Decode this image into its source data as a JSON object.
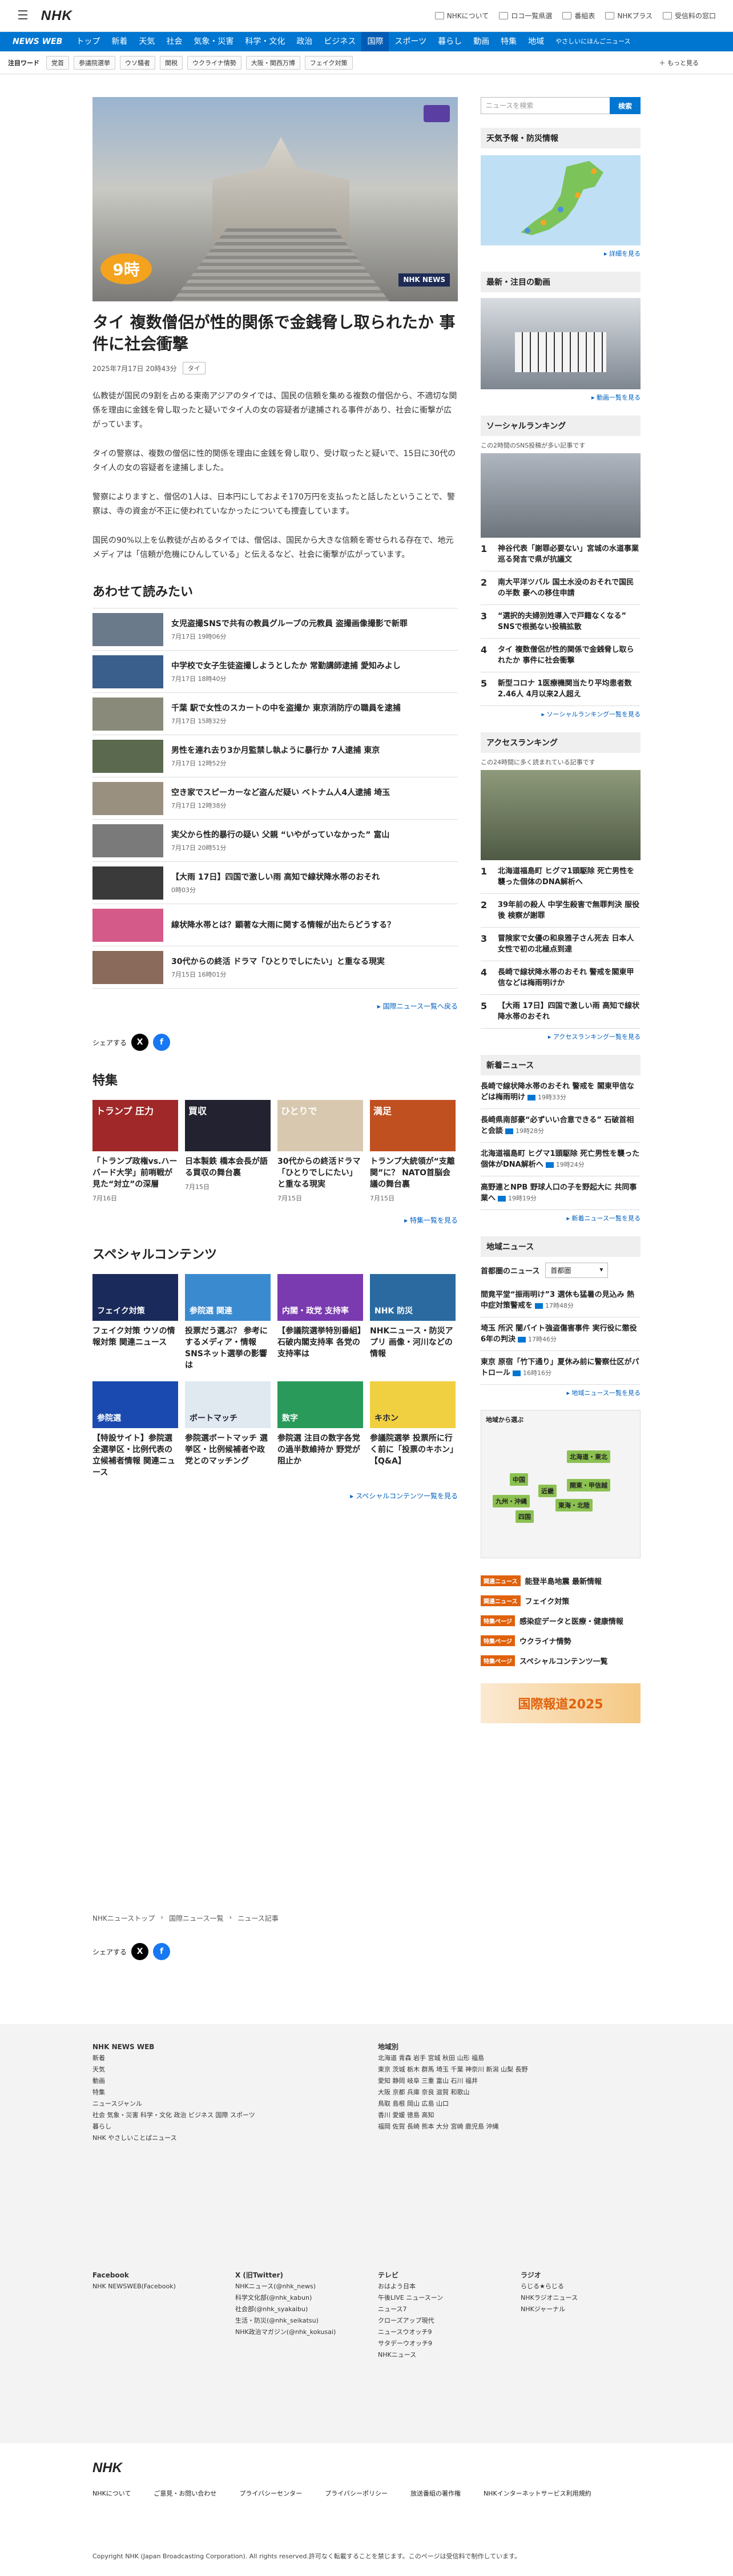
{
  "header": {
    "logo": "NHK",
    "menu_icon": "hamburger-icon",
    "links": [
      "NHKについて",
      "ロコ一覧県選",
      "番組表",
      "NHKプラス",
      "受信料の窓口"
    ]
  },
  "nav": {
    "brand": "NEWS WEB",
    "items": [
      "トップ",
      "新着",
      "天気",
      "社会",
      "気象・災害",
      "科学・文化",
      "政治",
      "ビジネス",
      "国際",
      "スポーツ",
      "暮らし",
      "動画",
      "特集",
      "地域",
      "やさしいにほんごニュース"
    ],
    "active": "国際"
  },
  "keywords": {
    "label": "注目ワード",
    "items": [
      "党首",
      "参議院選挙",
      "ウソ騒者",
      "関税",
      "ウクライナ情勢",
      "大阪・関西万博",
      "フェイク対策"
    ],
    "more": "もっと見る"
  },
  "article": {
    "title": "タイ 複数僧侶が性的関係で金銭脅し取られたか 事件に社会衝撃",
    "date": "2025年7月17日 20時43分",
    "tag": "タイ",
    "hero_badge": "9時",
    "hero_logo": "NHK NEWS",
    "paragraphs": [
      "仏教徒が国民の9割を占める東南アジアのタイでは、国民の信頼を集める複数の僧侶から、不適切な関係を理由に金銭を脅し取ったと疑いでタイ人の女の容疑者が逮捕される事件があり、社会に衝撃が広がっています。",
      "タイの警察は、複数の僧侶に性的関係を理由に金銭を脅し取り、受け取ったと疑いで、15日に30代のタイ人の女の容疑者を逮捕しました。",
      "警察によりますと、僧侶の1人は、日本円にしておよそ170万円を支払ったと話したということで、警察は、寺の資金が不正に使われていなかったについても捜査しています。",
      "国民の90%以上を仏教徒が占めるタイでは、僧侶は、国民から大きな信頼を寄せられる存在で、地元メディアは「信頼が危機にひんしている」と伝えるなど、社会に衝撃が広がっています。"
    ]
  },
  "related": {
    "heading": "あわせて読みたい",
    "items": [
      {
        "title": "女児盗撮SNSで共有の教員グループの元教員 盗撮画像撮影で新罪",
        "date": "7月17日 19時06分",
        "color": "#6a7a8a"
      },
      {
        "title": "中学校で女子生徒盗撮しようとしたか 常勤講師逮捕 愛知みよし",
        "date": "7月17日 18時40分",
        "color": "#3b5f8c"
      },
      {
        "title": "千葉 駅で女性のスカートの中を盗撮か 東京消防庁の職員を逮捕",
        "date": "7月17日 15時32分",
        "color": "#8a8a7a"
      },
      {
        "title": "男性を連れ去り3か月監禁し執ように暴行か 7人逮捕 東京",
        "date": "7月17日 12時52分",
        "color": "#5b6a4f"
      },
      {
        "title": "空き家でスピーカーなど盗んだ疑い ベトナム人4人逮捕 埼玉",
        "date": "7月17日 12時38分",
        "color": "#9a9080"
      },
      {
        "title": "実父から性的暴行の疑い 父親 “いやがっていなかった” 富山",
        "date": "7月17日 20時51分",
        "color": "#7a7a7a"
      },
      {
        "title": "【大雨 17日】四国で激しい雨 高知で線状降水帯のおそれ",
        "date": "0時03分",
        "color": "#3a3a3a"
      },
      {
        "title": "線状降水帯とは？顕著な大雨に関する情報が出たらどうする？",
        "date": "",
        "color": "#d45a8a"
      },
      {
        "title": "30代からの終活 ドラマ「ひとりでしにたい」と重なる現実",
        "date": "7月15日 16時01分",
        "color": "#8a6a5a"
      }
    ],
    "more": "国際ニュース一覧へ戻る"
  },
  "share": {
    "label": "シェアする"
  },
  "features": {
    "heading": "特集",
    "items": [
      {
        "title": "「トランプ政権vs.ハーバード大学」前哨戦が見た“対立”の深層",
        "date": "7月16日",
        "img": "トランプ 圧力",
        "color": "#a02828"
      },
      {
        "title": "日本製鉄 橋本会長が語る買収の舞台裏",
        "date": "7月15日",
        "img": "買収",
        "color": "#222230"
      },
      {
        "title": "30代からの終活ドラマ「ひとりでしにたい」と重なる現実",
        "date": "7月15日",
        "img": "ひとりで",
        "color": "#d8c8b0"
      },
      {
        "title": "トランプ大統領が“支離関”に？ NATO首脳会議の舞台裏",
        "date": "7月15日",
        "img": "満足",
        "color": "#c05020"
      }
    ],
    "more": "特集一覧を見る"
  },
  "special": {
    "heading": "スペシャルコンテンツ",
    "items": [
      {
        "title": "フェイク対策 ウソの情報対策 関連ニュース",
        "img": "フェイク対策",
        "color": "#1a2a5a"
      },
      {
        "title": "投票だう選ぶ？ 参考にするメディア・情報 SNSネット選挙の影響は",
        "img": "参院選 関連",
        "color": "#3a8ad0"
      },
      {
        "title": "【参議院選挙特別番組】石破内閣支持率 各党の支持率は",
        "img": "内閣・政党 支持率",
        "color": "#7a3ab0"
      },
      {
        "title": "NHKニュース・防災アプリ 画像・河川などの情報",
        "img": "NHK 防災",
        "color": "#2a6aa0"
      },
      {
        "title": "【特設サイト】参院選 全選挙区・比例代表の立候補者情報 関連ニュース",
        "img": "参院選",
        "color": "#1a4ab0"
      },
      {
        "title": "参院選ボートマッチ 選挙区・比例候補者や政党とのマッチング",
        "img": "ボートマッチ",
        "color": "#e0e8f0"
      },
      {
        "title": "参院選 注目の数字各党の過半数維持か 野党が阻止か",
        "img": "数字",
        "color": "#2a9a5a"
      },
      {
        "title": "参議院選挙 投票所に行く前に「投票のキホン」【Q&A】",
        "img": "キホン",
        "color": "#f0d040"
      }
    ],
    "more": "スペシャルコンテンツ一覧を見る"
  },
  "sidebar": {
    "search_placeholder": "ニュースを検索",
    "search_button": "検索",
    "weather": {
      "heading": "天気予報・防災情報",
      "more": "詳細を見る"
    },
    "video": {
      "heading": "最新・注目の動画",
      "more": "動画一覧を見る"
    },
    "social": {
      "heading": "ソーシャルランキング",
      "sub": "この2時間のSNS投稿が多い記事です",
      "items": [
        "神谷代表「謝罪必要ない」宮城の水道事業巡る発言で県が抗議文",
        "南大平洋ツバル 国土水没のおそれで国民の半数 豪への移住申請",
        "“選択的夫婦別姓導入で戸籍なくなる” SNSで根拠ない投稿拡散",
        "タイ 複数僧侶が性的関係で金銭脅し取られたか 事件に社会衝撃",
        "新型コロナ 1医療機関当たり平均患者数2.46人 4月以来2人超え"
      ],
      "more": "ソーシャルランキング一覧を見る"
    },
    "access": {
      "heading": "アクセスランキング",
      "sub": "この24時間に多く読まれている記事です",
      "items": [
        "北海道福島町 ヒグマ1頭駆除 死亡男性を襲った個体のDNA解析へ",
        "39年前の殺人 中学生殺害で無罪判決 服役後 検察が謝罪",
        "冒険家で女優の和泉雅子さん死去 日本人女性で初の北極点到達",
        "長崎で線状降水帯のおそれ 警戒を閣東甲信などは梅雨明けか",
        "【大雨 17日】四国で激しい雨 高知で線状降水帯のおそれ"
      ],
      "more": "アクセスランキング一覧を見る"
    },
    "news": {
      "heading": "新着ニュース",
      "items": [
        {
          "t": "長崎で線状降水帯のおそれ 警戒を 閣東甲信などは梅雨明け",
          "tm": "19時33分"
        },
        {
          "t": "長崎県南部豪“必ずいい合意できる” 石破首相と会談",
          "tm": "19時28分"
        },
        {
          "t": "北海道福島町 ヒグマ1頭駆除 死亡男性を襲った個体がDNA解析へ",
          "tm": "19時24分"
        },
        {
          "t": "高野連とNPB 野球人口の子を野起大に 共同事業へ",
          "tm": "19時19分"
        }
      ],
      "more": "新着ニュース一覧を見る"
    },
    "region": {
      "heading": "地域ニュース",
      "label": "首都圏のニュース",
      "select": "首都圏",
      "items": [
        {
          "t": "間竟平堂“振雨明け”3 選休も猛暑の見込み 熱中症対策警戒を",
          "tm": "17時48分"
        },
        {
          "t": "埼玉 所沢 闇バイト強盗傷害事件 実行役に懲役6年の判決",
          "tm": "17時46分"
        },
        {
          "t": "東京 原宿「竹下通り」夏休み前に警察仕区がパトロール",
          "tm": "16時16分"
        }
      ],
      "more": "地域ニュース一覧を見る",
      "map_title": "地域から選ぶ",
      "regions": [
        "北海道・東北",
        "中国",
        "九州・沖縄",
        "近畿",
        "関東・甲信越",
        "東海・北陸",
        "四国"
      ]
    },
    "specials": [
      {
        "lbl": "関連ニュース",
        "t": "能登半島地震 最新情報"
      },
      {
        "lbl": "関連ニュース",
        "t": "フェイク対策"
      },
      {
        "lbl": "特集ページ",
        "t": "感染症データと医療・健康情報"
      },
      {
        "lbl": "特集ページ",
        "t": "ウクライナ情勢"
      },
      {
        "lbl": "特集ページ",
        "t": "スペシャルコンテンツ一覧"
      }
    ],
    "banner": "国際報道2025"
  },
  "breadcrumb": [
    "NHKニューストップ",
    "国際ニュース一覧",
    "ニュース記事"
  ],
  "footer": {
    "brand": "NHK NEWS WEB",
    "col1": [
      "新着",
      "天気",
      "動画",
      "特集",
      "ニュースジャンル",
      "社会 気象・災害 科学・文化 政治 ビジネス 国際 スポーツ",
      "暮らし",
      "NHK やさしいことばニュース"
    ],
    "region_hd": "地域別",
    "regions": [
      "北海道 青森 岩手 宮城 秋田 山形 福島",
      "東京 茨城 栃木 群馬 埼玉 千葉 神奈川 新潟 山梨 長野",
      "愛知 静岡 岐阜 三重 富山 石川 福井",
      "大阪 京都 兵庫 奈良 滋賀 和歌山",
      "鳥取 島根 岡山 広島 山口",
      "香川 愛媛 徳島 高知",
      "福岡 佐賀 長崎 熊本 大分 宮崎 鹿児島 沖縄"
    ],
    "sns": [
      {
        "hd": "Facebook",
        "items": [
          "NHK NEWSWEB(Facebook)"
        ]
      },
      {
        "hd": "X (旧Twitter)",
        "items": [
          "NHKニュース(@nhk_news)",
          "科学文化部(@nhk_kabun)",
          "社会部(@nhk_syakaibu)",
          "生活・防災(@nhk_seikatsu)",
          "NHK政治マガジン(@nhk_kokusai)"
        ]
      },
      {
        "hd": "テレビ",
        "items": [
          "おはよう日本",
          "午後LIVE ニュースーン",
          "ニュース7",
          "クローズアップ現代",
          "ニュースウオッチ9",
          "サタデーウオッチ9",
          "NHKニュース"
        ]
      },
      {
        "hd": "ラジオ",
        "items": [
          "らじる★らじる",
          "NHKラジオニュース",
          "NHKジャーナル"
        ]
      }
    ],
    "bottom_logo": "NHK",
    "bottom_links": [
      "NHKについて",
      "ご意見・お問い合わせ",
      "プライバシーセンター",
      "プライバシーポリシー",
      "放送番組の著作権",
      "NHKインターネットサービス利用規約"
    ],
    "copyright": "Copyright NHK (Japan Broadcasting Corporation). All rights reserved.許可なく転載することを禁じます。このページは受信料で制作しています。"
  }
}
